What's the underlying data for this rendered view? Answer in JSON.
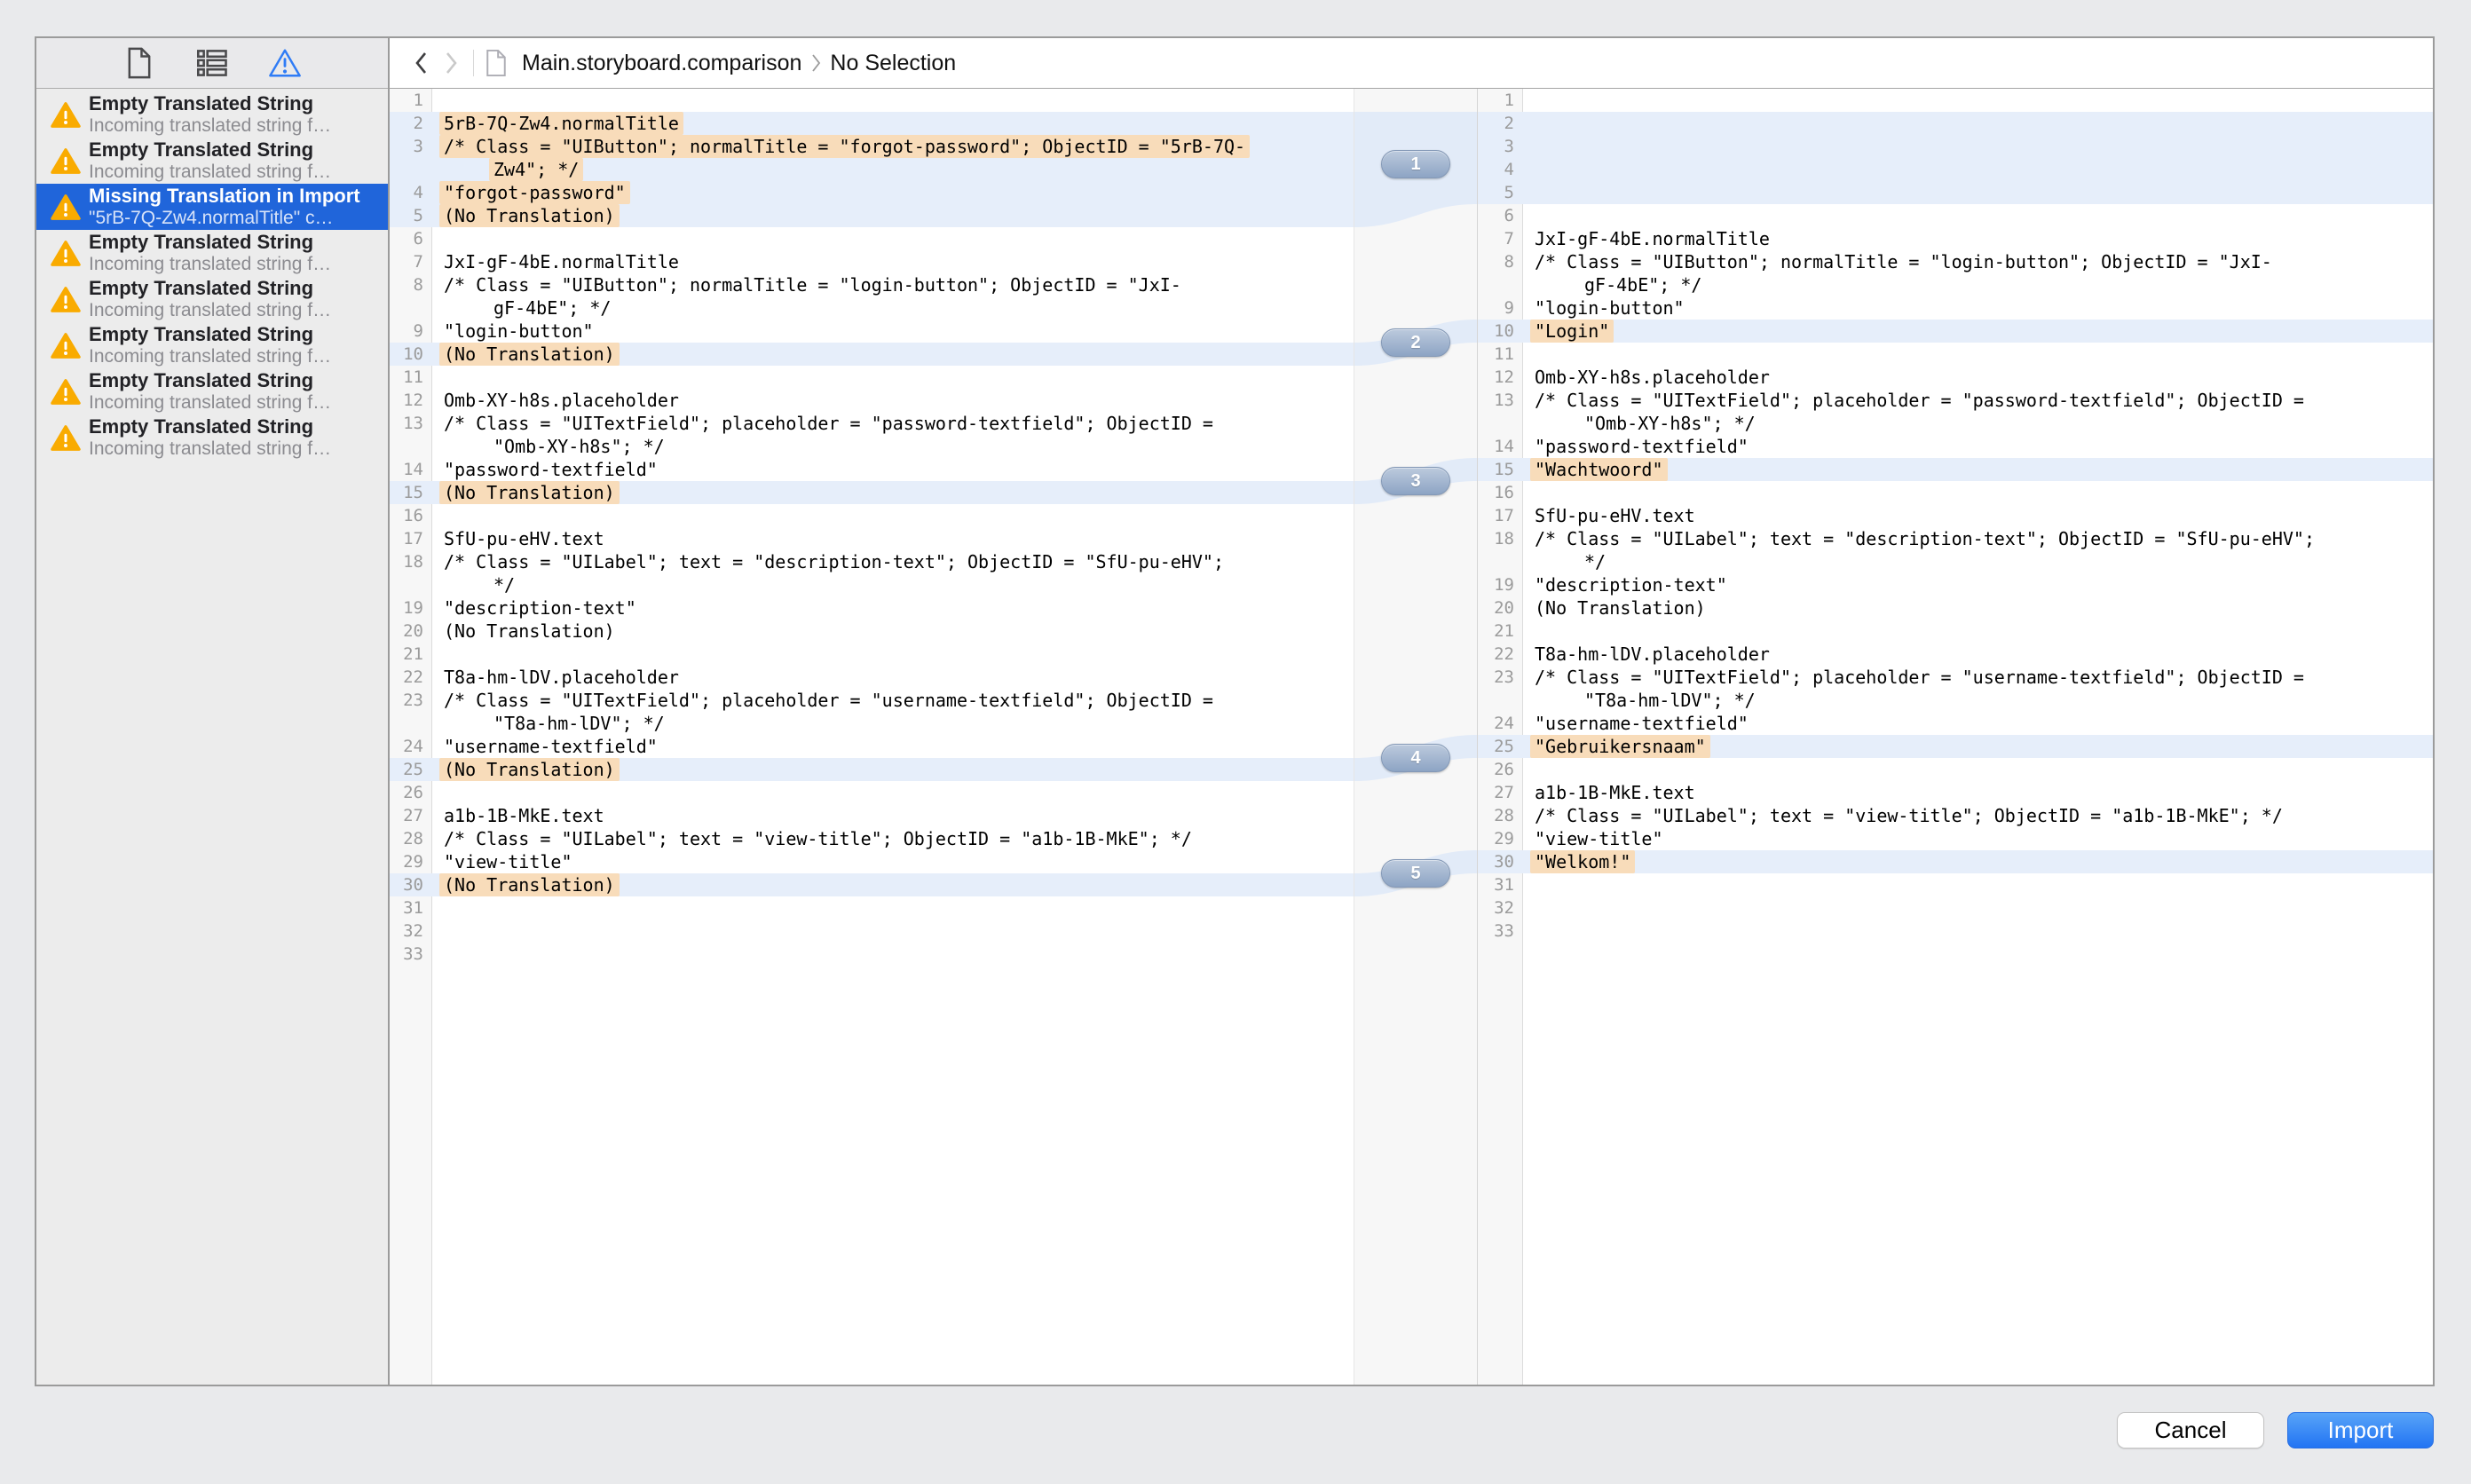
{
  "colors": {
    "selection_blue": "#2065da",
    "row_highlight_blue": "#e6eefa",
    "change_highlight_orange": "#f8dcba",
    "warning_orange": "#f9ab00",
    "import_button_blue": "#2e7df4",
    "badge_gray_blue": "#93a9c6"
  },
  "sidebar": {
    "tabs": [
      {
        "icon": "document-icon",
        "active": false
      },
      {
        "icon": "list-icon",
        "active": false
      },
      {
        "icon": "warning-icon",
        "active": true
      }
    ],
    "issues": [
      {
        "title": "Empty Translated String",
        "subtitle": "Incoming translated string f…",
        "selected": false
      },
      {
        "title": "Empty Translated String",
        "subtitle": "Incoming translated string f…",
        "selected": false
      },
      {
        "title": "Missing Translation in Import",
        "subtitle": "\"5rB-7Q-Zw4.normalTitle\" c…",
        "selected": true
      },
      {
        "title": "Empty Translated String",
        "subtitle": "Incoming translated string f…",
        "selected": false
      },
      {
        "title": "Empty Translated String",
        "subtitle": "Incoming translated string f…",
        "selected": false
      },
      {
        "title": "Empty Translated String",
        "subtitle": "Incoming translated string f…",
        "selected": false
      },
      {
        "title": "Empty Translated String",
        "subtitle": "Incoming translated string f…",
        "selected": false
      },
      {
        "title": "Empty Translated String",
        "subtitle": "Incoming translated string f…",
        "selected": false
      }
    ]
  },
  "jumpbar": {
    "file": "Main.storyboard.comparison",
    "selection": "No Selection"
  },
  "diffs": [
    {
      "id": 1,
      "label": "1"
    },
    {
      "id": 2,
      "label": "2"
    },
    {
      "id": 3,
      "label": "3"
    },
    {
      "id": 4,
      "label": "4"
    },
    {
      "id": 5,
      "label": "5"
    }
  ],
  "panes": {
    "left": {
      "rows": [
        {
          "n": "1",
          "text": ""
        },
        {
          "n": "2",
          "text": "5rB-7Q-Zw4.normalTitle",
          "hl": true,
          "mark": true,
          "diff": 1
        },
        {
          "n": "3",
          "text": "/* Class = \"UIButton\"; normalTitle = \"forgot-password\"; ObjectID = \"5rB-7Q-",
          "hl": true,
          "mark": true,
          "diff": 1
        },
        {
          "n": "",
          "text": "Zw4\"; */",
          "hl": true,
          "mark": true,
          "indent": true,
          "diff": 1
        },
        {
          "n": "4",
          "text": "\"forgot-password\"",
          "hl": true,
          "mark": true,
          "diff": 1
        },
        {
          "n": "5",
          "text": "(No Translation)",
          "hl": true,
          "mark": true,
          "diff": 1
        },
        {
          "n": "6",
          "text": ""
        },
        {
          "n": "7",
          "text": "JxI-gF-4bE.normalTitle"
        },
        {
          "n": "8",
          "text": "/* Class = \"UIButton\"; normalTitle = \"login-button\"; ObjectID = \"JxI-"
        },
        {
          "n": "",
          "text": "gF-4bE\"; */",
          "indent": true
        },
        {
          "n": "9",
          "text": "\"login-button\""
        },
        {
          "n": "10",
          "text": "(No Translation)",
          "hl": true,
          "mark": true,
          "diff": 2
        },
        {
          "n": "11",
          "text": ""
        },
        {
          "n": "12",
          "text": "Omb-XY-h8s.placeholder"
        },
        {
          "n": "13",
          "text": "/* Class = \"UITextField\"; placeholder = \"password-textfield\"; ObjectID ="
        },
        {
          "n": "",
          "text": "\"Omb-XY-h8s\"; */",
          "indent": true
        },
        {
          "n": "14",
          "text": "\"password-textfield\""
        },
        {
          "n": "15",
          "text": "(No Translation)",
          "hl": true,
          "mark": true,
          "diff": 3
        },
        {
          "n": "16",
          "text": ""
        },
        {
          "n": "17",
          "text": "SfU-pu-eHV.text"
        },
        {
          "n": "18",
          "text": "/* Class = \"UILabel\"; text = \"description-text\"; ObjectID = \"SfU-pu-eHV\";"
        },
        {
          "n": "",
          "text": "*/",
          "indent": true
        },
        {
          "n": "19",
          "text": "\"description-text\""
        },
        {
          "n": "20",
          "text": "(No Translation)"
        },
        {
          "n": "21",
          "text": ""
        },
        {
          "n": "22",
          "text": "T8a-hm-lDV.placeholder"
        },
        {
          "n": "23",
          "text": "/* Class = \"UITextField\"; placeholder = \"username-textfield\"; ObjectID ="
        },
        {
          "n": "",
          "text": "\"T8a-hm-lDV\"; */",
          "indent": true
        },
        {
          "n": "24",
          "text": "\"username-textfield\""
        },
        {
          "n": "25",
          "text": "(No Translation)",
          "hl": true,
          "mark": true,
          "diff": 4
        },
        {
          "n": "26",
          "text": ""
        },
        {
          "n": "27",
          "text": "a1b-1B-MkE.text"
        },
        {
          "n": "28",
          "text": "/* Class = \"UILabel\"; text = \"view-title\"; ObjectID = \"a1b-1B-MkE\"; */"
        },
        {
          "n": "29",
          "text": "\"view-title\""
        },
        {
          "n": "30",
          "text": "(No Translation)",
          "hl": true,
          "mark": true,
          "diff": 5
        },
        {
          "n": "31",
          "text": ""
        },
        {
          "n": "32",
          "text": ""
        },
        {
          "n": "33",
          "text": ""
        }
      ]
    },
    "right": {
      "rows": [
        {
          "n": "1",
          "text": ""
        },
        {
          "n": "2",
          "text": "",
          "hl": true,
          "diff": 1
        },
        {
          "n": "3",
          "text": "",
          "hl": true,
          "diff": 1
        },
        {
          "n": "4",
          "text": "",
          "hl": true,
          "diff": 1
        },
        {
          "n": "5",
          "text": "",
          "hl": true,
          "diff": 1
        },
        {
          "n": "6",
          "text": ""
        },
        {
          "n": "7",
          "text": "JxI-gF-4bE.normalTitle"
        },
        {
          "n": "8",
          "text": "/* Class = \"UIButton\"; normalTitle = \"login-button\"; ObjectID = \"JxI-"
        },
        {
          "n": "",
          "text": "gF-4bE\"; */",
          "indent": true
        },
        {
          "n": "9",
          "text": "\"login-button\""
        },
        {
          "n": "10",
          "text": "\"Login\"",
          "hl": true,
          "mark": true,
          "diff": 2
        },
        {
          "n": "11",
          "text": ""
        },
        {
          "n": "12",
          "text": "Omb-XY-h8s.placeholder"
        },
        {
          "n": "13",
          "text": "/* Class = \"UITextField\"; placeholder = \"password-textfield\"; ObjectID ="
        },
        {
          "n": "",
          "text": "\"Omb-XY-h8s\"; */",
          "indent": true
        },
        {
          "n": "14",
          "text": "\"password-textfield\""
        },
        {
          "n": "15",
          "text": "\"Wachtwoord\"",
          "hl": true,
          "mark": true,
          "diff": 3
        },
        {
          "n": "16",
          "text": ""
        },
        {
          "n": "17",
          "text": "SfU-pu-eHV.text"
        },
        {
          "n": "18",
          "text": "/* Class = \"UILabel\"; text = \"description-text\"; ObjectID = \"SfU-pu-eHV\";"
        },
        {
          "n": "",
          "text": "*/",
          "indent": true
        },
        {
          "n": "19",
          "text": "\"description-text\""
        },
        {
          "n": "20",
          "text": "(No Translation)"
        },
        {
          "n": "21",
          "text": ""
        },
        {
          "n": "22",
          "text": "T8a-hm-lDV.placeholder"
        },
        {
          "n": "23",
          "text": "/* Class = \"UITextField\"; placeholder = \"username-textfield\"; ObjectID ="
        },
        {
          "n": "",
          "text": "\"T8a-hm-lDV\"; */",
          "indent": true
        },
        {
          "n": "24",
          "text": "\"username-textfield\""
        },
        {
          "n": "25",
          "text": "\"Gebruikersnaam\"",
          "hl": true,
          "mark": true,
          "diff": 4
        },
        {
          "n": "26",
          "text": ""
        },
        {
          "n": "27",
          "text": "a1b-1B-MkE.text"
        },
        {
          "n": "28",
          "text": "/* Class = \"UILabel\"; text = \"view-title\"; ObjectID = \"a1b-1B-MkE\"; */"
        },
        {
          "n": "29",
          "text": "\"view-title\""
        },
        {
          "n": "30",
          "text": "\"Welkom!\"",
          "hl": true,
          "mark": true,
          "diff": 5
        },
        {
          "n": "31",
          "text": ""
        },
        {
          "n": "32",
          "text": ""
        },
        {
          "n": "33",
          "text": ""
        }
      ]
    }
  },
  "footer": {
    "cancel_label": "Cancel",
    "import_label": "Import"
  }
}
